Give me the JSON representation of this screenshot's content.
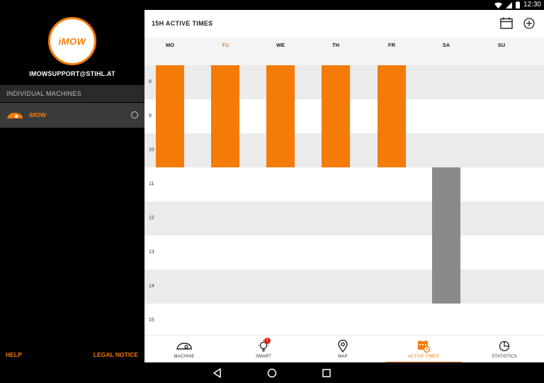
{
  "status_bar": {
    "time": "12:30"
  },
  "drawer": {
    "logo_text": "iMOW",
    "account_email": "IMOWSUPPORT@STIHL.AT",
    "section_header": "INDIVIDUAL MACHINES",
    "machine": {
      "name": "iMOW",
      "selected": false
    },
    "footer": {
      "help": "HELP",
      "legal": "LEGAL NOTICE"
    }
  },
  "toolbar": {
    "title": "15H ACTIVE TIMES"
  },
  "schedule": {
    "days": [
      "MO",
      "TU",
      "WE",
      "TH",
      "FR",
      "SA",
      "SU"
    ],
    "today_index": 1,
    "hours": [
      "8",
      "9",
      "10",
      "11",
      "12",
      "13",
      "14",
      "15"
    ],
    "blocks": [
      {
        "day": "MO",
        "start": 8,
        "end": 11,
        "type": "active"
      },
      {
        "day": "TU",
        "start": 8,
        "end": 11,
        "type": "active"
      },
      {
        "day": "WE",
        "start": 8,
        "end": 11,
        "type": "active"
      },
      {
        "day": "TH",
        "start": 8,
        "end": 11,
        "type": "active"
      },
      {
        "day": "FR",
        "start": 8,
        "end": 11,
        "type": "active"
      },
      {
        "day": "SA",
        "start": 11,
        "end": 15,
        "type": "inactive"
      }
    ]
  },
  "bottom_nav": {
    "items": [
      {
        "label": "MACHINE",
        "icon": "mower-icon",
        "active": false
      },
      {
        "label": "SMART",
        "icon": "lightbulb-icon",
        "active": false,
        "badge": "!"
      },
      {
        "label": "MAP",
        "icon": "map-pin-icon",
        "active": false
      },
      {
        "label": "ACTIVE TIMES",
        "icon": "calendar-clock-icon",
        "active": true
      },
      {
        "label": "STATISTICS",
        "icon": "pie-chart-icon",
        "active": false
      }
    ]
  },
  "colors": {
    "accent": "#f47b07",
    "inactive_block": "#8a8a8a",
    "row_shade": "#ebebeb"
  }
}
